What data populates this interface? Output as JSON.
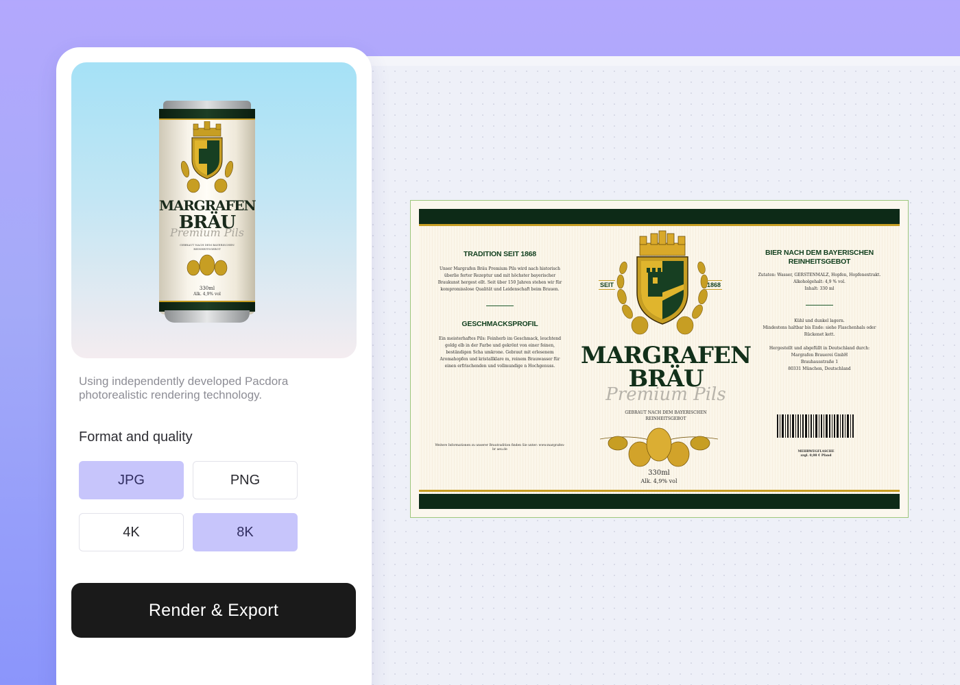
{
  "panel": {
    "caption": "Using independently developed Pacdora photorealistic rendering technology.",
    "format_title": "Format and quality",
    "options": [
      {
        "label": "JPG",
        "selected": true
      },
      {
        "label": "PNG",
        "selected": false
      },
      {
        "label": "4K",
        "selected": false
      },
      {
        "label": "8K",
        "selected": true
      }
    ],
    "render_button": "Render & Export"
  },
  "can": {
    "brand_line1": "MARGRAFEN",
    "brand_line2": "BRÄU",
    "script": "Premium Pils",
    "sub": "GEBRAUT NACH DEM BAYERISCHEN REINHEITSGEBOT",
    "volume": "330ml",
    "abv": "Alk. 4,9% vol"
  },
  "label": {
    "left": {
      "heading1": "TRADITION SEIT 1868",
      "text1": "Unser Margrafen Bräu Premium Pils wird nach historisch überlie ferter Rezeptur und mit höchster bayerischer Braukunst hergest ellt. Seit über 150 Jahren stehen wir für kompromisslose Qualität und Leidenschaft beim Brauen.",
      "heading2": "GESCHMACKSPROFIL",
      "text2": "Ein meisterhaftes Pils: Feinherb im Geschmack, leuchtend goldg elb in der Farbe und gekrönt von einer feinen, beständigen Scha umkrone. Gebraut mit erlesenem Aromahopfen und kristallklare m, reinem Brauwasser für einen erfrischenden und vollmundige n Hochgenuss.",
      "footer": "Weitere Informationen zu unserer Brautradition finden Sie unter: www.margrafen-br aeu.de"
    },
    "center": {
      "seit": "SEIT",
      "year": "1868",
      "brand_line1": "MARGRAFEN",
      "brand_line2": "BRÄU",
      "script": "Premium Pils",
      "sub": "GEBRAUT NACH DEM BAYERISCHEN REINHEITSGEBOT",
      "volume": "330ml",
      "abv": "Alk. 4,9% vol"
    },
    "right": {
      "heading": "BIER NACH DEM BAYERISCHEN REINHEITSGEBOT",
      "ingredients": "Zutaten: Wasser, GERSTENMALZ, Hopfen, Hopfenextrakt.",
      "alcohol": "Alkoholgehalt: 4,9 % vol.",
      "content": "Inhalt: 330 ml",
      "storage": "Kühl und dunkel lagern.",
      "best_before": "Mindestens haltbar bis Ende: siehe Flaschenhals oder Rückenet kett.",
      "made_by": "Hergestellt und abgefüllt in Deutschland durch:",
      "company": "Margrafen Brauerei GmbH",
      "street": "Brauhausstraße 1",
      "city": "80331 München, Deutschland",
      "deposit1": "MEHRWEGFLASCHE",
      "deposit2": "zzgl. 0,08 € Pfand"
    }
  },
  "colors": {
    "accent": "#c7c5fb",
    "dark_green": "#0d2a17",
    "gold": "#c79e23",
    "button": "#1a1a1a"
  }
}
